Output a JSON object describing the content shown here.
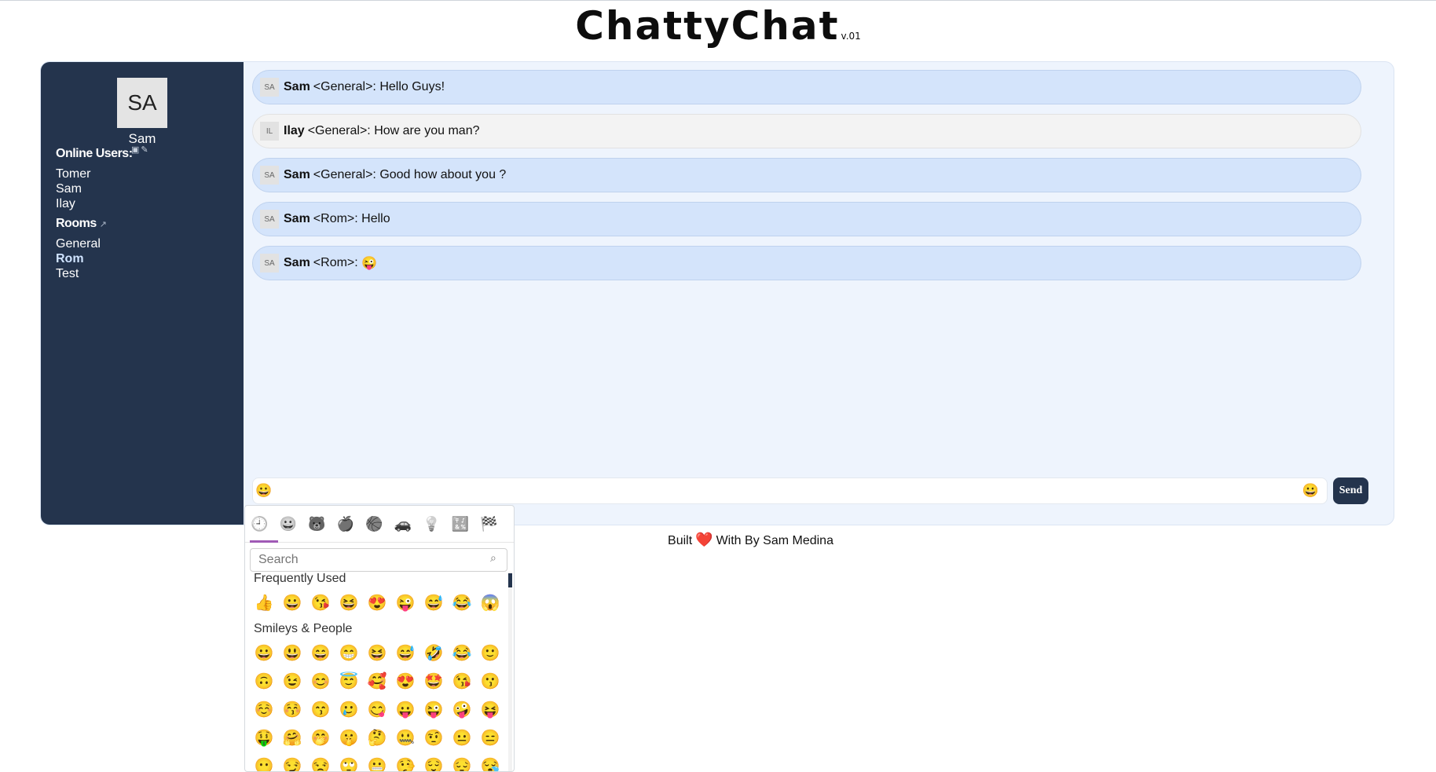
{
  "app": {
    "title": "ChattyChat",
    "version": "v.01"
  },
  "profile": {
    "initials": "SA",
    "name": "Sam"
  },
  "sidebar": {
    "online_title": "Online Users:",
    "online_users": [
      "Tomer",
      "Sam",
      "Ilay"
    ],
    "rooms_title": "Rooms",
    "rooms": [
      "General",
      "Rom",
      "Test"
    ],
    "active_room": "Rom"
  },
  "messages": [
    {
      "initials": "SA",
      "author": "Sam",
      "room": "<General>:",
      "text": "Hello Guys!",
      "own": true
    },
    {
      "initials": "IL",
      "author": "Ilay",
      "room": "<General>:",
      "text": "How are you man?",
      "own": false
    },
    {
      "initials": "SA",
      "author": "Sam",
      "room": "<General>:",
      "text": "Good how about you ?",
      "own": true
    },
    {
      "initials": "SA",
      "author": "Sam",
      "room": "<Rom>:",
      "text": "Hello",
      "own": true
    },
    {
      "initials": "SA",
      "author": "Sam",
      "room": "<Rom>:",
      "text": "😜",
      "own": true
    }
  ],
  "composer": {
    "value": "😀",
    "emoji_toggle": "😀",
    "send_label": "Send"
  },
  "footer": {
    "prefix": "Built",
    "heart": "❤️",
    "suffix": "With By Sam Medina"
  },
  "emoji_picker": {
    "tabs": [
      "🕘",
      "😀",
      "🐻",
      "🍎",
      "🏀",
      "🚗",
      "💡",
      "🔣",
      "🏁"
    ],
    "active_tab": 0,
    "search_placeholder": "Search",
    "frequently_used_label": "Frequently Used",
    "frequently_used": [
      "👍",
      "😀",
      "😘",
      "😆",
      "😍",
      "😜",
      "😅",
      "😂",
      "😱"
    ],
    "smileys_label": "Smileys & People",
    "smileys": [
      "😀",
      "😃",
      "😄",
      "😁",
      "😆",
      "😅",
      "🤣",
      "😂",
      "🙂",
      "🙃",
      "😉",
      "😊",
      "😇",
      "🥰",
      "😍",
      "🤩",
      "😘",
      "😗",
      "☺️",
      "😚",
      "😙",
      "🥲",
      "😋",
      "😛",
      "😜",
      "🤪",
      "😝",
      "🤑",
      "🤗",
      "🤭",
      "🤫",
      "🤔",
      "🤐",
      "🤨",
      "😐",
      "😑",
      "😶",
      "😏",
      "😒",
      "🙄",
      "😬",
      "🤥",
      "😌",
      "😔",
      "😪"
    ]
  }
}
